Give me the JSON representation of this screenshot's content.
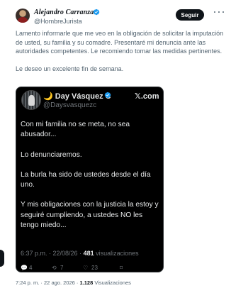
{
  "author": {
    "name": "Alejandro Carranza",
    "handle": "@HombreJurista",
    "follow_label": "Seguir"
  },
  "tweet": {
    "paragraph1": "Lamento informarle que me veo en la obligación de solicitar la imputación de usted, su familia y su comadre.  Presentaré mi denuncia ante las autoridades competentes. Le recomiendo tomar las medidas pertinentes.",
    "paragraph2": "Le deseo un excelente fin de semana."
  },
  "quoted": {
    "name": "🌙 Day Vásquez C",
    "handle": "@Daysvasquezc",
    "platform": "𝕏.com",
    "lines": [
      "Con mi familia no se meta, no sea abusador...",
      "Lo denunciaremos.",
      "La burla ha sido de ustedes desde el día uno.",
      "Y mis obligaciones con la justicia la estoy y seguiré cumpliendo, a ustedes NO les tengo miedo..."
    ],
    "time": "6:37 p.m. · 22/08/26 · ",
    "views_count": "481",
    "views_label": " visualizaciones",
    "actions": {
      "replies": "4",
      "reposts": "7",
      "likes": "23"
    }
  },
  "footer": {
    "time": "7:24 p. m. · 22 ago. 2026 · ",
    "views_count": "1.128",
    "views_label": " Visualizaciones"
  },
  "colors": {
    "verified_badge": "#1d9bf0",
    "text_secondary": "#536471",
    "quote_background": "#000000"
  }
}
